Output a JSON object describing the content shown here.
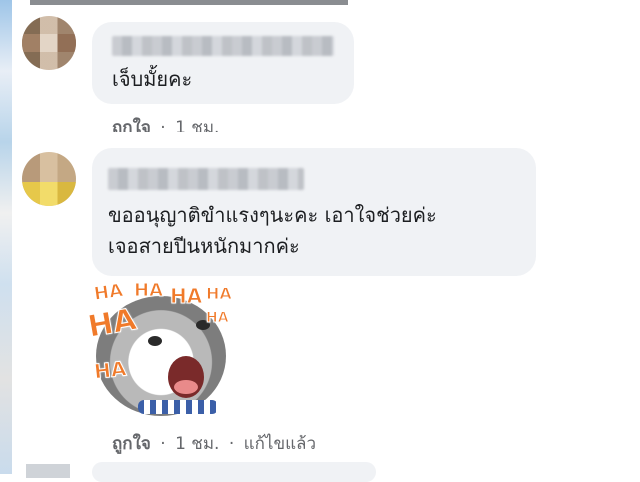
{
  "comments": [
    {
      "author_name_blurred": true,
      "text_lines": [
        "เจ็บมั้ยคะ"
      ],
      "actions": {
        "like_label": "ถูกใจ",
        "separator": "·",
        "time": "1 ชม."
      }
    },
    {
      "author_name_blurred": true,
      "text_lines": [
        "ขออนุญาติขำแรงๆนะคะ เอาใจช่วยค่ะ",
        "เจอสายปีนหนักมากค่ะ"
      ],
      "sticker": {
        "icon": "laughing-cat-sticker",
        "text_marks": [
          "HA",
          "HA",
          "HA",
          "HA",
          "HA",
          "HA",
          "HA"
        ]
      },
      "actions": {
        "like_label": "ถูกใจ",
        "separator": "·",
        "time": "1 ชม.",
        "edited_label": "แก้ไขแล้ว"
      }
    }
  ],
  "colors": {
    "bubble": "#f0f2f5",
    "secondary_text": "#65676b",
    "primary_text": "#1c1e21",
    "ha_text": "#f07a2a"
  }
}
